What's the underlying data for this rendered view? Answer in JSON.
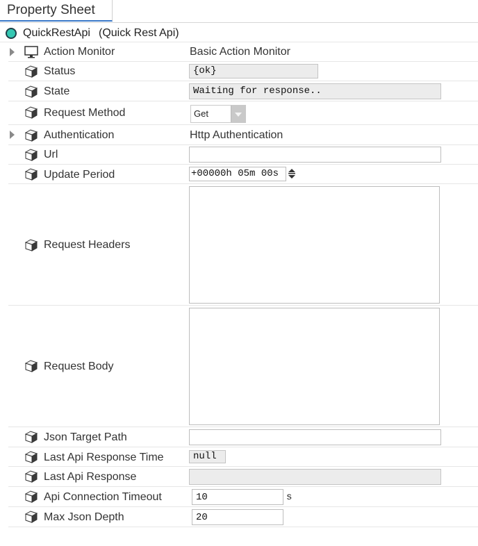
{
  "tab": {
    "label": "Property Sheet"
  },
  "root": {
    "name": "QuickRestApi",
    "type": "(Quick Rest Api)"
  },
  "properties": {
    "action_monitor": {
      "label": "Action Monitor",
      "value": "Basic Action Monitor"
    },
    "status": {
      "label": "Status",
      "value": "{ok}"
    },
    "state": {
      "label": "State",
      "value": "Waiting for response.."
    },
    "request_method": {
      "label": "Request Method",
      "value": "Get"
    },
    "authentication": {
      "label": "Authentication",
      "value": "Http Authentication"
    },
    "url": {
      "label": "Url",
      "value": ""
    },
    "update_period": {
      "label": "Update Period",
      "value": "+00000h 05m 00s"
    },
    "request_headers": {
      "label": "Request Headers",
      "value": ""
    },
    "request_body": {
      "label": "Request Body",
      "value": ""
    },
    "json_target_path": {
      "label": "Json Target Path",
      "value": ""
    },
    "last_api_response_time": {
      "label": "Last Api Response Time",
      "value": "null"
    },
    "last_api_response": {
      "label": "Last Api Response",
      "value": ""
    },
    "api_connection_timeout": {
      "label": "Api Connection Timeout",
      "value": "10",
      "unit": "s"
    },
    "max_json_depth": {
      "label": "Max Json Depth",
      "value": "20"
    }
  },
  "icons": {
    "root": "status-circle-icon",
    "action_monitor": "monitor-icon",
    "property": "slot-cube-icon",
    "expander": "expand-triangle-icon",
    "spinner": "time-spinner-icon"
  },
  "colors": {
    "tab_accent": "#3a78c8",
    "root_dot": "#35c8b3"
  }
}
